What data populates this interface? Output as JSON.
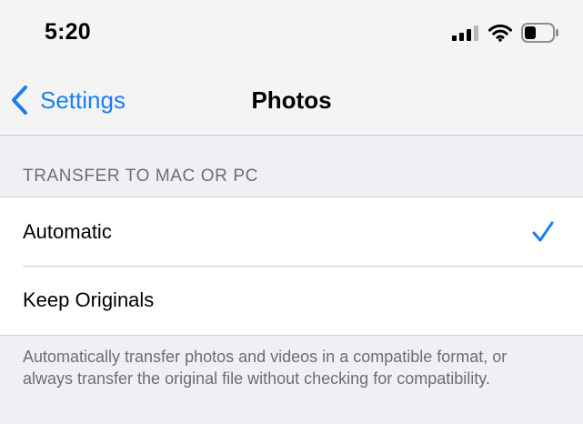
{
  "status_bar": {
    "time": "5:20",
    "icons": [
      "cellular-signal-icon",
      "wifi-icon",
      "battery-icon"
    ]
  },
  "nav": {
    "back_label": "Settings",
    "back_icon": "chevron-left-icon",
    "title": "Photos"
  },
  "section": {
    "header": "TRANSFER TO MAC OR PC",
    "options": [
      {
        "label": "Automatic",
        "selected": true
      },
      {
        "label": "Keep Originals",
        "selected": false
      }
    ],
    "footer": "Automatically transfer photos and videos in a compatible format, or always transfer the original file without checking for compatibility."
  },
  "colors": {
    "accent": "#1a7ef2",
    "background": "#efeff4",
    "secondary_text": "#6d6d72"
  }
}
